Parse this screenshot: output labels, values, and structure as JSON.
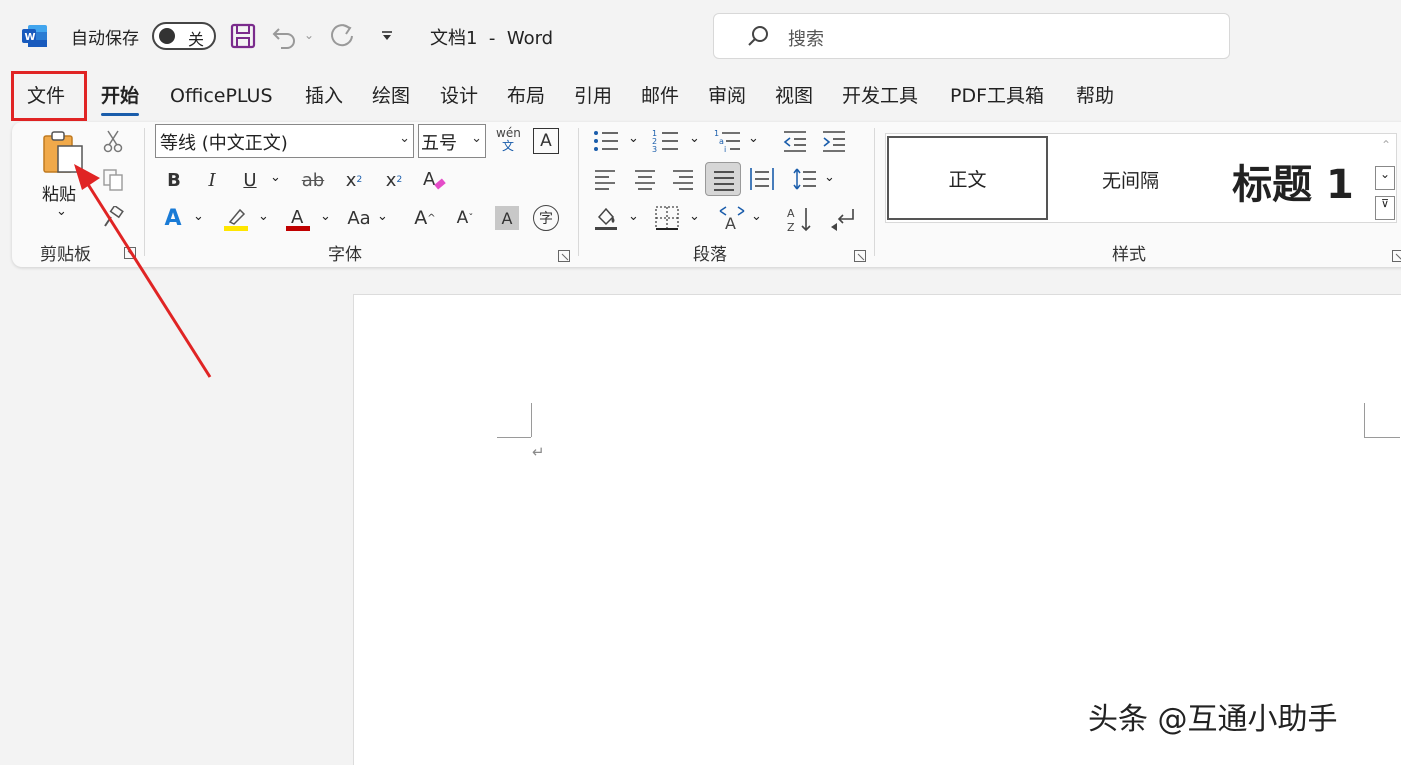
{
  "titlebar": {
    "autosave_label": "自动保存",
    "toggle_state": "关",
    "doc_title": "文档1  -  Word",
    "search_placeholder": "搜索"
  },
  "tabs": [
    "文件",
    "开始",
    "OfficePLUS",
    "插入",
    "绘图",
    "设计",
    "布局",
    "引用",
    "邮件",
    "审阅",
    "视图",
    "开发工具",
    "PDF工具箱",
    "帮助"
  ],
  "active_tab": "开始",
  "ribbon": {
    "clipboard": {
      "paste_label": "粘贴",
      "group_label": "剪贴板"
    },
    "font": {
      "font_name": "等线 (中文正文)",
      "font_size": "五号",
      "group_label": "字体",
      "phonetic_top": "wén",
      "phonetic_bottom": "文"
    },
    "paragraph": {
      "group_label": "段落"
    },
    "styles": {
      "group_label": "样式",
      "items": [
        "正文",
        "无间隔",
        "标题 1"
      ]
    }
  },
  "document": {
    "paragraph_mark": "↵"
  },
  "watermark": "头条 @互通小助手",
  "colors": {
    "highlight_red": "#e02424",
    "accent_blue": "#1a5dab",
    "highlight_yellow": "#ffe600",
    "font_color_red": "#c00000"
  }
}
